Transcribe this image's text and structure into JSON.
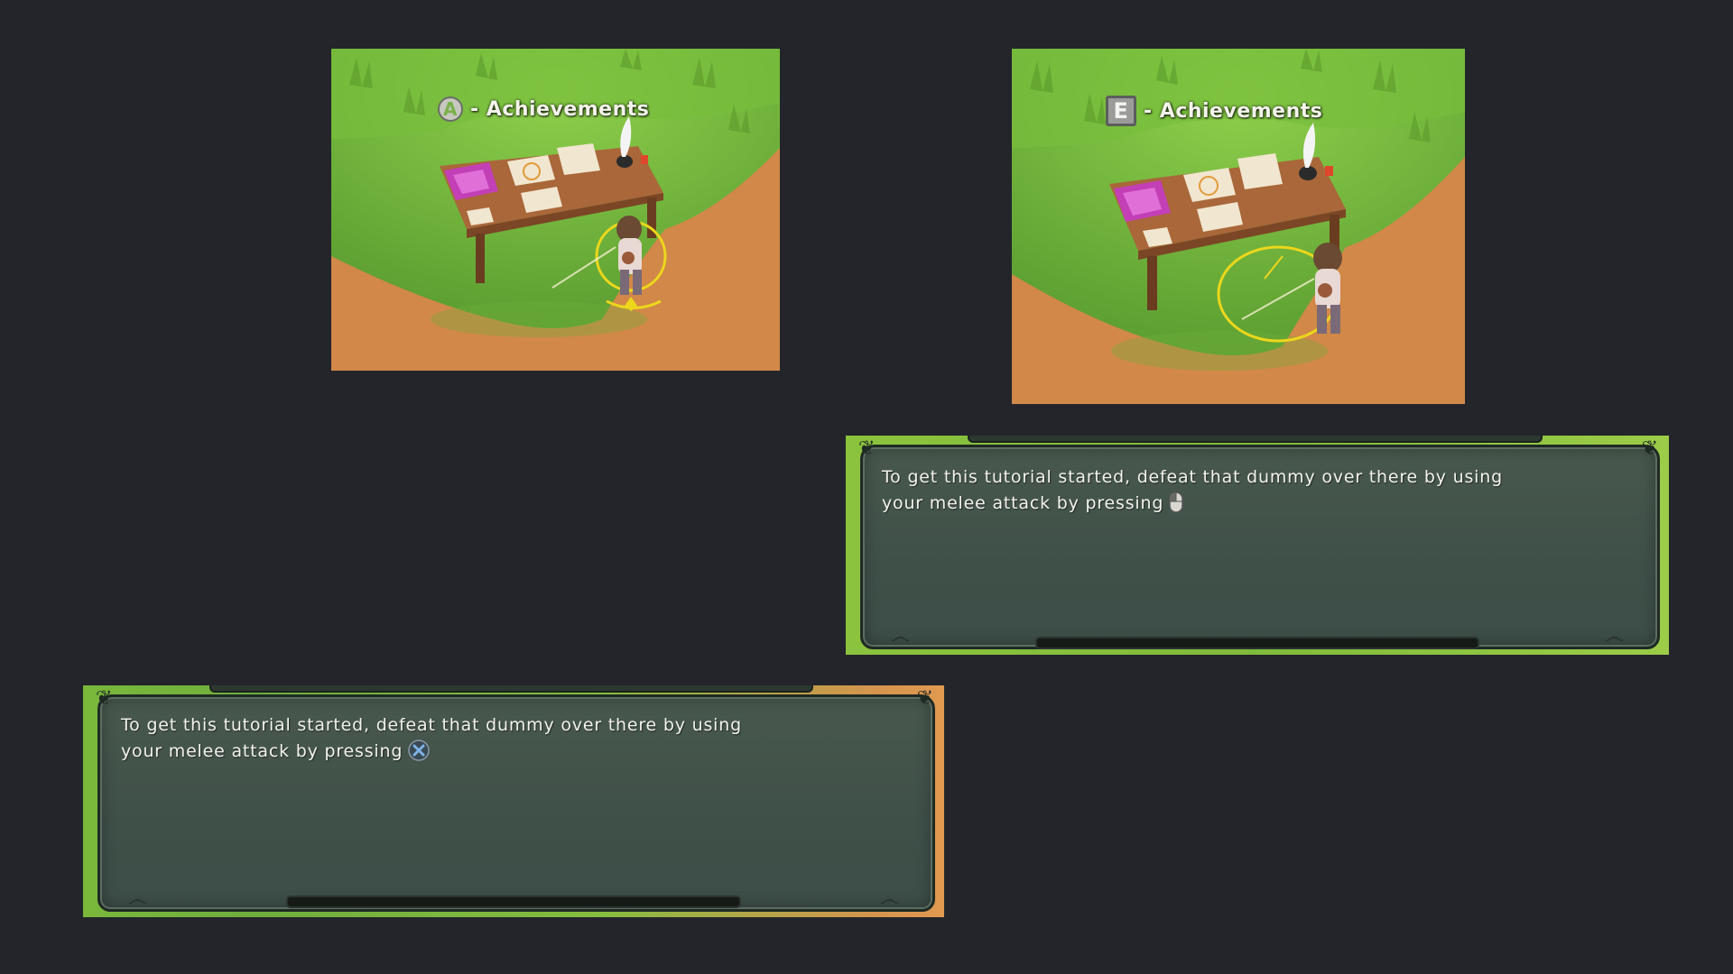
{
  "screenshots": {
    "controller": {
      "button": "A",
      "label": "- Achievements"
    },
    "keyboard": {
      "button": "E",
      "label": "- Achievements"
    }
  },
  "dialogs": {
    "keyboard": {
      "line1": "To get this tutorial started, defeat that dummy over there by using",
      "line2": "your melee attack by pressing",
      "input_icon": "mouse-left-click-icon"
    },
    "controller": {
      "line1": "To get this tutorial started, defeat that dummy over there by using",
      "line2": "your melee attack by pressing",
      "input_icon": "cross-button-icon"
    }
  },
  "colors": {
    "background": "#24252b",
    "panel": "#435349",
    "grass": "#6fae3c",
    "dirt": "#d5894a",
    "ring": "#e8d21c"
  }
}
